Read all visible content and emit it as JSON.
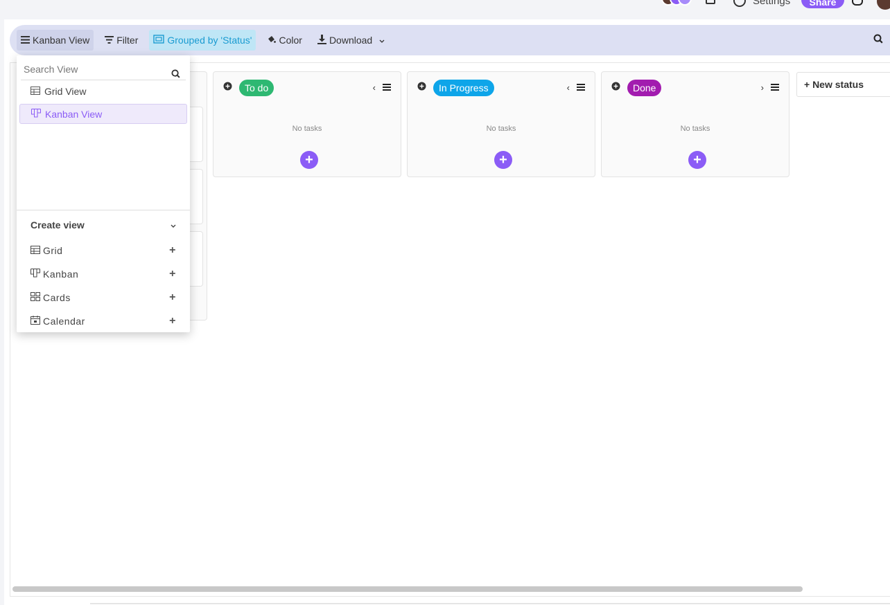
{
  "toolbar": {
    "view_label": "Kanban View",
    "filter_label": "Filter",
    "grouped_label": "Grouped by 'Status'",
    "color_label": "Color",
    "download_label": "Download"
  },
  "header": {
    "settings_label": "Settings",
    "share_label": "Share"
  },
  "columns": [
    {
      "label": "To do",
      "color": "#2eb872",
      "empty_text": "No tasks"
    },
    {
      "label": "In Progress",
      "color": "#0ea5e9",
      "empty_text": "No tasks"
    },
    {
      "label": "Done",
      "color": "#a21caf",
      "empty_text": "No tasks"
    }
  ],
  "new_status_label": "+ New status",
  "dropdown": {
    "search_placeholder": "Search View",
    "views": [
      {
        "label": "Grid View",
        "icon": "grid-icon"
      },
      {
        "label": "Kanban View",
        "icon": "kanban-icon",
        "selected": true
      }
    ],
    "create_view_label": "Create view",
    "create_items": [
      {
        "label": "Grid",
        "icon": "grid-icon"
      },
      {
        "label": "Kanban",
        "icon": "kanban-icon"
      },
      {
        "label": "Cards",
        "icon": "cards-icon"
      },
      {
        "label": "Calendar",
        "icon": "calendar-icon"
      }
    ]
  },
  "colors": {
    "accent": "#8b5cf6",
    "toolbar_bg": "#dde0f3"
  }
}
